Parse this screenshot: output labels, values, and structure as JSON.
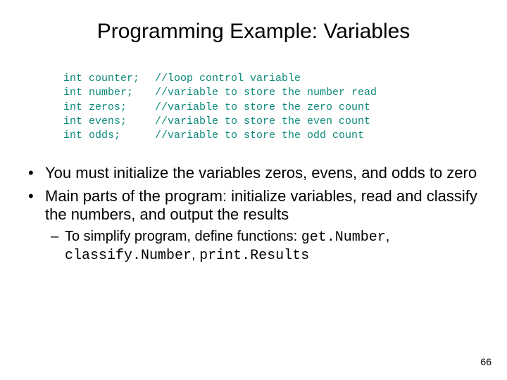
{
  "title": "Programming Example: Variables",
  "code": [
    {
      "decl": "int counter;",
      "comment": "//loop control variable"
    },
    {
      "decl": "int number;",
      "comment": "//variable to store the number read"
    },
    {
      "decl": "int zeros;",
      "comment": "//variable to store the zero count"
    },
    {
      "decl": "int evens;",
      "comment": "//variable to store the even count"
    },
    {
      "decl": "int odds;",
      "comment": "//variable to store the odd count"
    }
  ],
  "bullets": [
    "You must initialize the variables zeros, evens, and odds to zero",
    "Main parts of the program: initialize variables, read and classify the numbers, and output the results"
  ],
  "sub": {
    "prefix": "To simplify program, define functions: ",
    "fn1": "get.Number",
    "sep1": ", ",
    "fn2": "classify.Number",
    "sep2": ", ",
    "fn3": "print.Results"
  },
  "page_number": "66",
  "glyphs": {
    "bullet": "•",
    "dash": "–"
  }
}
